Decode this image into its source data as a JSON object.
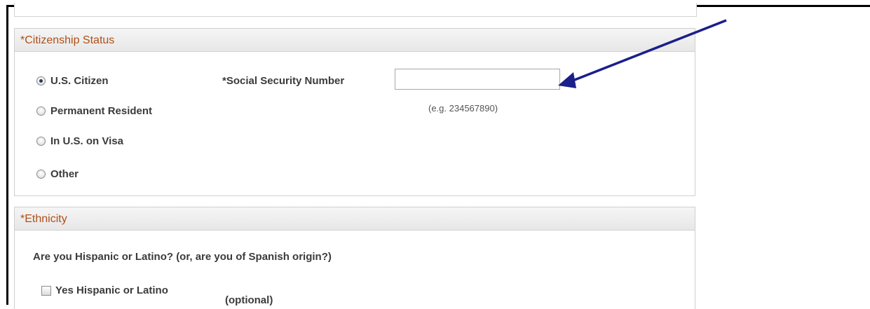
{
  "citizenship": {
    "header": "*Citizenship Status",
    "options": [
      {
        "label": "U.S. Citizen",
        "checked": true
      },
      {
        "label": "Permanent Resident",
        "checked": false
      },
      {
        "label": "In U.S. on Visa",
        "checked": false
      },
      {
        "label": "Other",
        "checked": false
      }
    ],
    "ssn_label": "*Social Security Number",
    "ssn_value": "",
    "ssn_hint": "(e.g. 234567890)"
  },
  "ethnicity": {
    "header": "*Ethnicity",
    "question": "Are you Hispanic or Latino? (or, are you of Spanish origin?)",
    "checkbox_label": "Yes Hispanic or Latino",
    "checkbox_checked": false,
    "optional_note": "(optional)"
  },
  "annotation": {
    "arrow_color": "#1a1f8a"
  },
  "colors": {
    "header_text": "#b04f18",
    "border": "#cfcfcf"
  }
}
